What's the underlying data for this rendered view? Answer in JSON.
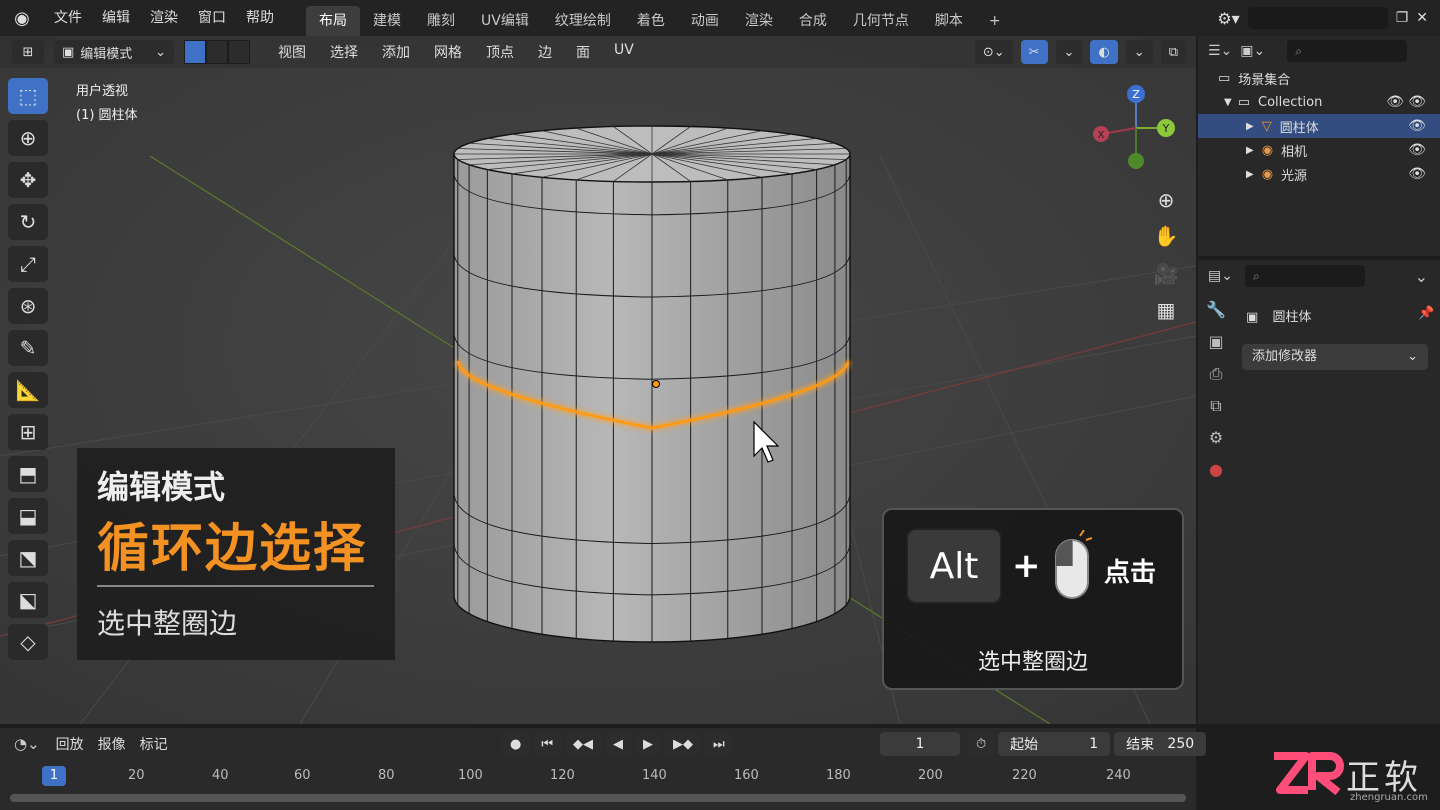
{
  "topbar": {
    "menu": [
      "文件",
      "编辑",
      "渲染",
      "窗口",
      "帮助"
    ],
    "workspaces": [
      "布局",
      "建模",
      "雕刻",
      "UV编辑",
      "纹理绘制",
      "着色",
      "动画",
      "渲染",
      "合成",
      "几何节点",
      "脚本"
    ],
    "active_workspace_index": 0,
    "add_label": "+"
  },
  "viewport": {
    "mode_label": "编辑模式",
    "menu": [
      "视图",
      "选择",
      "添加",
      "网格",
      "顶点",
      "边",
      "面",
      "UV"
    ],
    "view_label": "用户透视",
    "object_label": "(1) 圆柱体",
    "gizmo": {
      "z": "Z",
      "y": "Y",
      "x": "X"
    }
  },
  "overlay_left": {
    "mode": "编辑模式",
    "title": "循环边选择",
    "subtitle": "选中整圈边"
  },
  "overlay_right": {
    "key": "Alt",
    "plus": "+",
    "action": "点击",
    "caption": "选中整圈边"
  },
  "outliner": {
    "root": "场景集合",
    "collection": "Collection",
    "items": [
      "圆柱体",
      "相机",
      "光源"
    ],
    "selected_index": 0
  },
  "properties": {
    "object_name": "圆柱体",
    "add_modifier": "添加修改器"
  },
  "timeline": {
    "playback": "回放",
    "keying": "报像",
    "markers": "标记",
    "current_frame": "1",
    "start_label": "起始",
    "start": "1",
    "end_label": "结束",
    "end": "250",
    "ruler": [
      "1",
      "20",
      "40",
      "60",
      "80",
      "100",
      "120",
      "140",
      "160",
      "180",
      "200",
      "220",
      "240"
    ]
  },
  "watermark": {
    "text": "正软",
    "url": "zhengruan.com"
  },
  "colors": {
    "accent": "#3f72c7",
    "highlight": "#f39223"
  }
}
